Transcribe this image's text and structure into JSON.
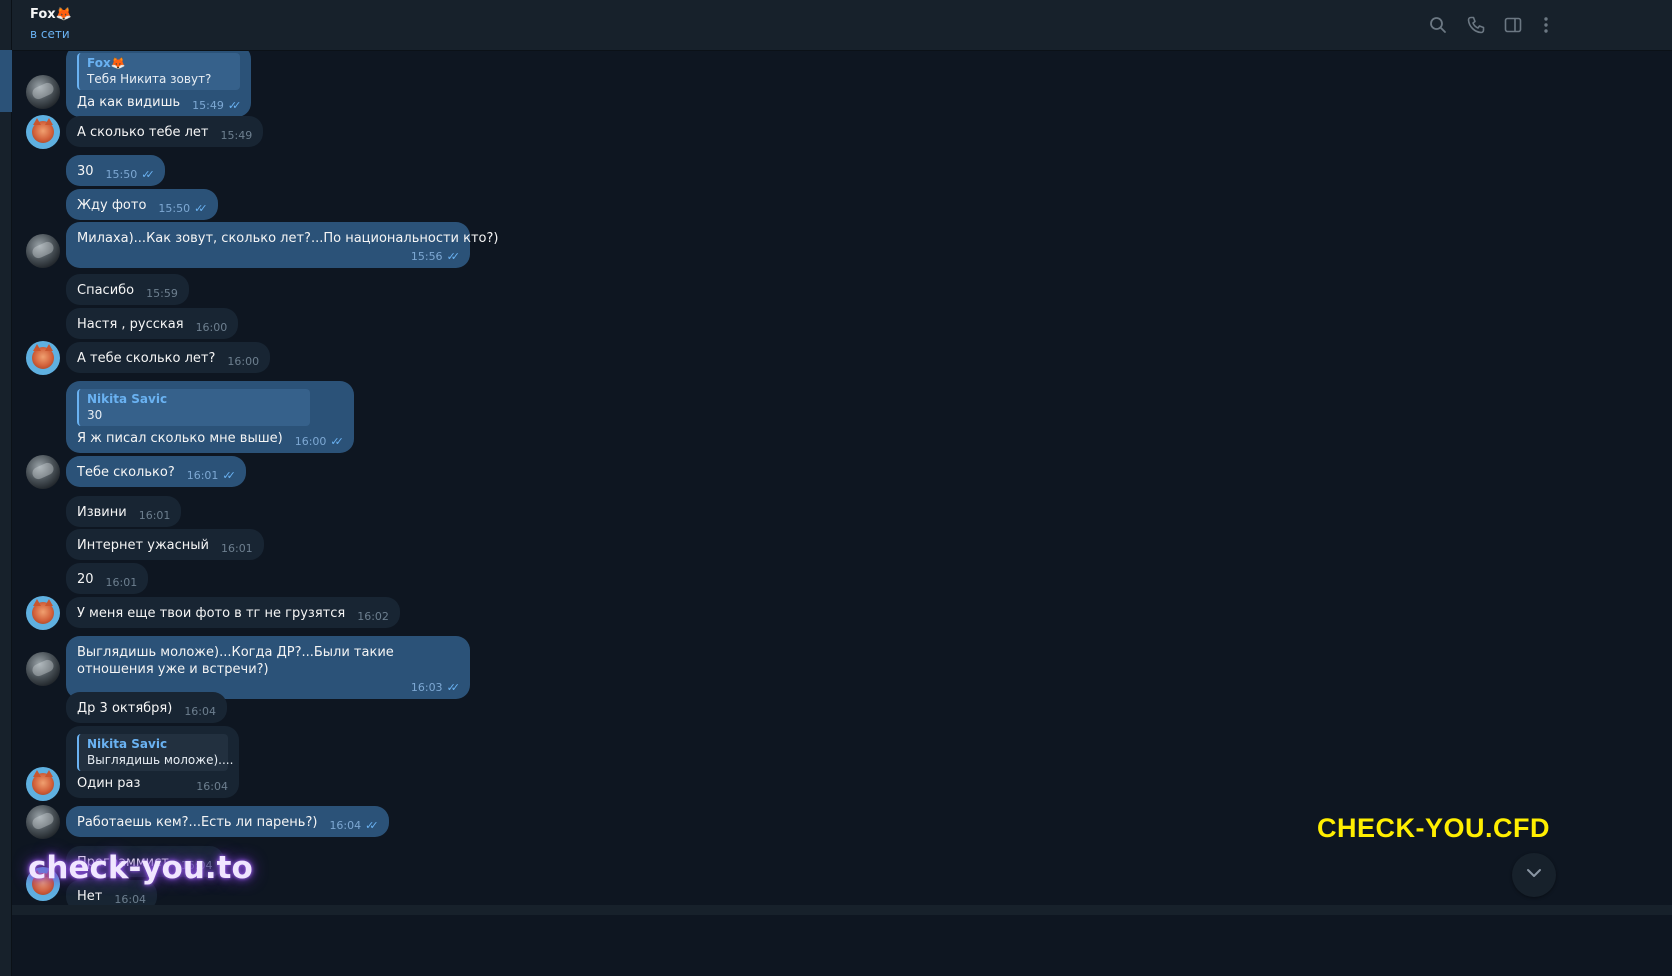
{
  "header": {
    "title": "Fox🦊",
    "status": "в сети"
  },
  "header_icons": [
    "search-icon",
    "phone-icon",
    "sidebar-toggle-icon",
    "more-vertical-icon"
  ],
  "messages": [
    {
      "dir": "out",
      "reply_name": "Fox🦊",
      "reply_text": "Тебя Никита зовут?",
      "text": "Да как видишь",
      "time": "15:49",
      "read": true
    },
    {
      "dir": "in",
      "text": "А сколько тебе лет",
      "time": "15:49"
    },
    {
      "dir": "out",
      "text": "30",
      "time": "15:50",
      "read": true
    },
    {
      "dir": "out",
      "text": "Жду фото",
      "time": "15:50",
      "read": true
    },
    {
      "dir": "out",
      "text": "Милаха)...Как зовут, сколько лет?...По национальности кто?)",
      "time": "15:56",
      "read": true
    },
    {
      "dir": "in",
      "text": "Спасибо",
      "time": "15:59"
    },
    {
      "dir": "in",
      "text": "Настя , русская",
      "time": "16:00"
    },
    {
      "dir": "in",
      "text": "А тебе сколько лет?",
      "time": "16:00"
    },
    {
      "dir": "out",
      "reply_name": "Nikita Savic",
      "reply_text": "30",
      "text": "Я ж писал сколько мне выше)",
      "time": "16:00",
      "read": true
    },
    {
      "dir": "out",
      "text": "Тебе сколько?",
      "time": "16:01",
      "read": true
    },
    {
      "dir": "in",
      "text": "Извини",
      "time": "16:01"
    },
    {
      "dir": "in",
      "text": "Интернет ужасный",
      "time": "16:01"
    },
    {
      "dir": "in",
      "text": "20",
      "time": "16:01"
    },
    {
      "dir": "in",
      "text": "У меня еще твои фото в тг не грузятся",
      "time": "16:02"
    },
    {
      "dir": "out",
      "text": "Выглядишь моложе)...Когда ДР?...Были такие отношения уже и встречи?)",
      "time": "16:03",
      "read": true
    },
    {
      "dir": "in",
      "text": "Др 3 октября)",
      "time": "16:04"
    },
    {
      "dir": "in",
      "reply_name": "Nikita Savic",
      "reply_text": "Выглядишь моложе)....",
      "text": "Один раз",
      "time": "16:04"
    },
    {
      "dir": "out",
      "text": "Работаешь кем?...Есть ли парень?)",
      "time": "16:04",
      "read": true
    },
    {
      "dir": "in",
      "text": "Программист",
      "time": "16:04"
    },
    {
      "dir": "in",
      "text": "Нет",
      "time": "16:04"
    }
  ],
  "watermarks": {
    "yellow": "CHECK-YOU.CFD",
    "purple": "check-you.to"
  },
  "colors": {
    "background": "#0e1621",
    "outgoing_bubble": "#2b5278",
    "incoming_bubble": "#182533",
    "accent": "#6ab2f2"
  }
}
